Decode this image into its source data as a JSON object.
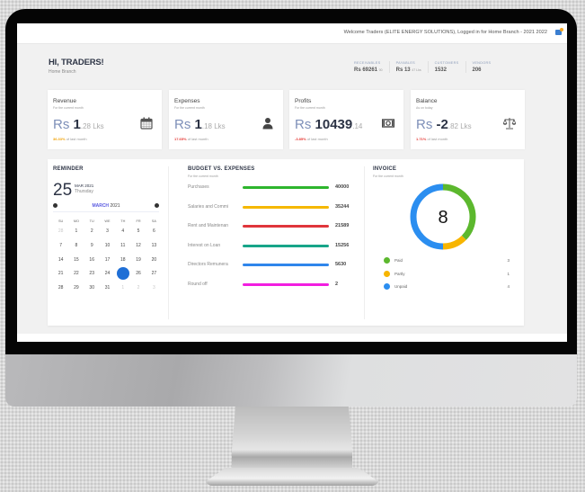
{
  "topbar": {
    "welcome": "Welcome Traders (ELITE ENERGY SOLUTIONS), Logged in for Home Branch - 2021 2022",
    "notification_icon": "notification-icon"
  },
  "greeting": {
    "title": "HI, TRADERS!",
    "branch": "Home Branch"
  },
  "stats": [
    {
      "label": "RECEIVABLES",
      "value": "Rs 69261",
      "unit": "00"
    },
    {
      "label": "PAYABLES",
      "value": "Rs 13",
      "unit": "47 Lks"
    },
    {
      "label": "CUSTOMERS",
      "value": "1532",
      "unit": ""
    },
    {
      "label": "VENDORS",
      "value": "206",
      "unit": ""
    }
  ],
  "cards": [
    {
      "title": "Revenue",
      "subtitle": "For the current month",
      "currency": "Rs",
      "main": "1",
      "suffix": ".28 Lks",
      "pct": "36.33%",
      "pct_color": "#f0a30a",
      "pct_note": "of last month",
      "icon": "calendar-icon"
    },
    {
      "title": "Expenses",
      "subtitle": "For the current month",
      "currency": "Rs",
      "main": "1",
      "suffix": ".18 Lks",
      "pct": "17.65%",
      "pct_color": "#e53935",
      "pct_note": "of last month",
      "icon": "user-icon"
    },
    {
      "title": "Profits",
      "subtitle": "For the current month",
      "currency": "Rs",
      "main": "10439",
      "suffix": ".14",
      "pct": "-3.85%",
      "pct_color": "#e53935",
      "pct_note": "of last month",
      "icon": "money-icon"
    },
    {
      "title": "Balance",
      "subtitle": "As on today",
      "currency": "Rs",
      "main": "-2",
      "suffix": ".82 Lks",
      "pct": "1.71%",
      "pct_color": "#e53935",
      "pct_note": "of last month",
      "icon": "balance-scale-icon"
    }
  ],
  "reminder": {
    "title": "REMINDER",
    "day": "25",
    "month_year": "MAR 2021",
    "weekday": "Thursday",
    "calendar_month": "MARCH",
    "calendar_year": "2021",
    "weekdays": [
      "SU",
      "MO",
      "TU",
      "WE",
      "TH",
      "FR",
      "SA"
    ],
    "days": [
      {
        "d": "28",
        "muted": true
      },
      {
        "d": "1"
      },
      {
        "d": "2"
      },
      {
        "d": "3"
      },
      {
        "d": "4"
      },
      {
        "d": "5"
      },
      {
        "d": "6"
      },
      {
        "d": "7"
      },
      {
        "d": "8"
      },
      {
        "d": "9"
      },
      {
        "d": "10"
      },
      {
        "d": "11"
      },
      {
        "d": "12"
      },
      {
        "d": "13"
      },
      {
        "d": "14"
      },
      {
        "d": "15"
      },
      {
        "d": "16"
      },
      {
        "d": "17"
      },
      {
        "d": "18"
      },
      {
        "d": "19"
      },
      {
        "d": "20"
      },
      {
        "d": "21"
      },
      {
        "d": "22"
      },
      {
        "d": "23"
      },
      {
        "d": "24"
      },
      {
        "d": "25",
        "selected": true
      },
      {
        "d": "26"
      },
      {
        "d": "27"
      },
      {
        "d": "28"
      },
      {
        "d": "29"
      },
      {
        "d": "30"
      },
      {
        "d": "31"
      },
      {
        "d": "1",
        "muted": true
      },
      {
        "d": "2",
        "muted": true
      },
      {
        "d": "3",
        "muted": true
      }
    ]
  },
  "budget": {
    "title": "BUDGET VS. EXPENSES",
    "subtitle": "For the current month",
    "rows": [
      {
        "name": "Purchases",
        "value": "40000",
        "color": "#2db52d"
      },
      {
        "name": "Salaries and Commi",
        "value": "35244",
        "color": "#f5b800"
      },
      {
        "name": "Rent and Maintenan",
        "value": "21589",
        "color": "#e0353b"
      },
      {
        "name": "Interest on Loan",
        "value": "15256",
        "color": "#17a589"
      },
      {
        "name": "Directors Remunera",
        "value": "5630",
        "color": "#2f86eb"
      },
      {
        "name": "Round off",
        "value": "2",
        "color": "#f21ee0"
      }
    ]
  },
  "invoice": {
    "title": "INVOICE",
    "subtitle": "For the current month",
    "total": "8",
    "legend": [
      {
        "label": "Paid",
        "count": 3,
        "color": "#5cb82e"
      },
      {
        "label": "Partly",
        "count": 1,
        "color": "#f7b500"
      },
      {
        "label": "Unpaid",
        "count": 4,
        "color": "#2b8ef0"
      }
    ]
  }
}
